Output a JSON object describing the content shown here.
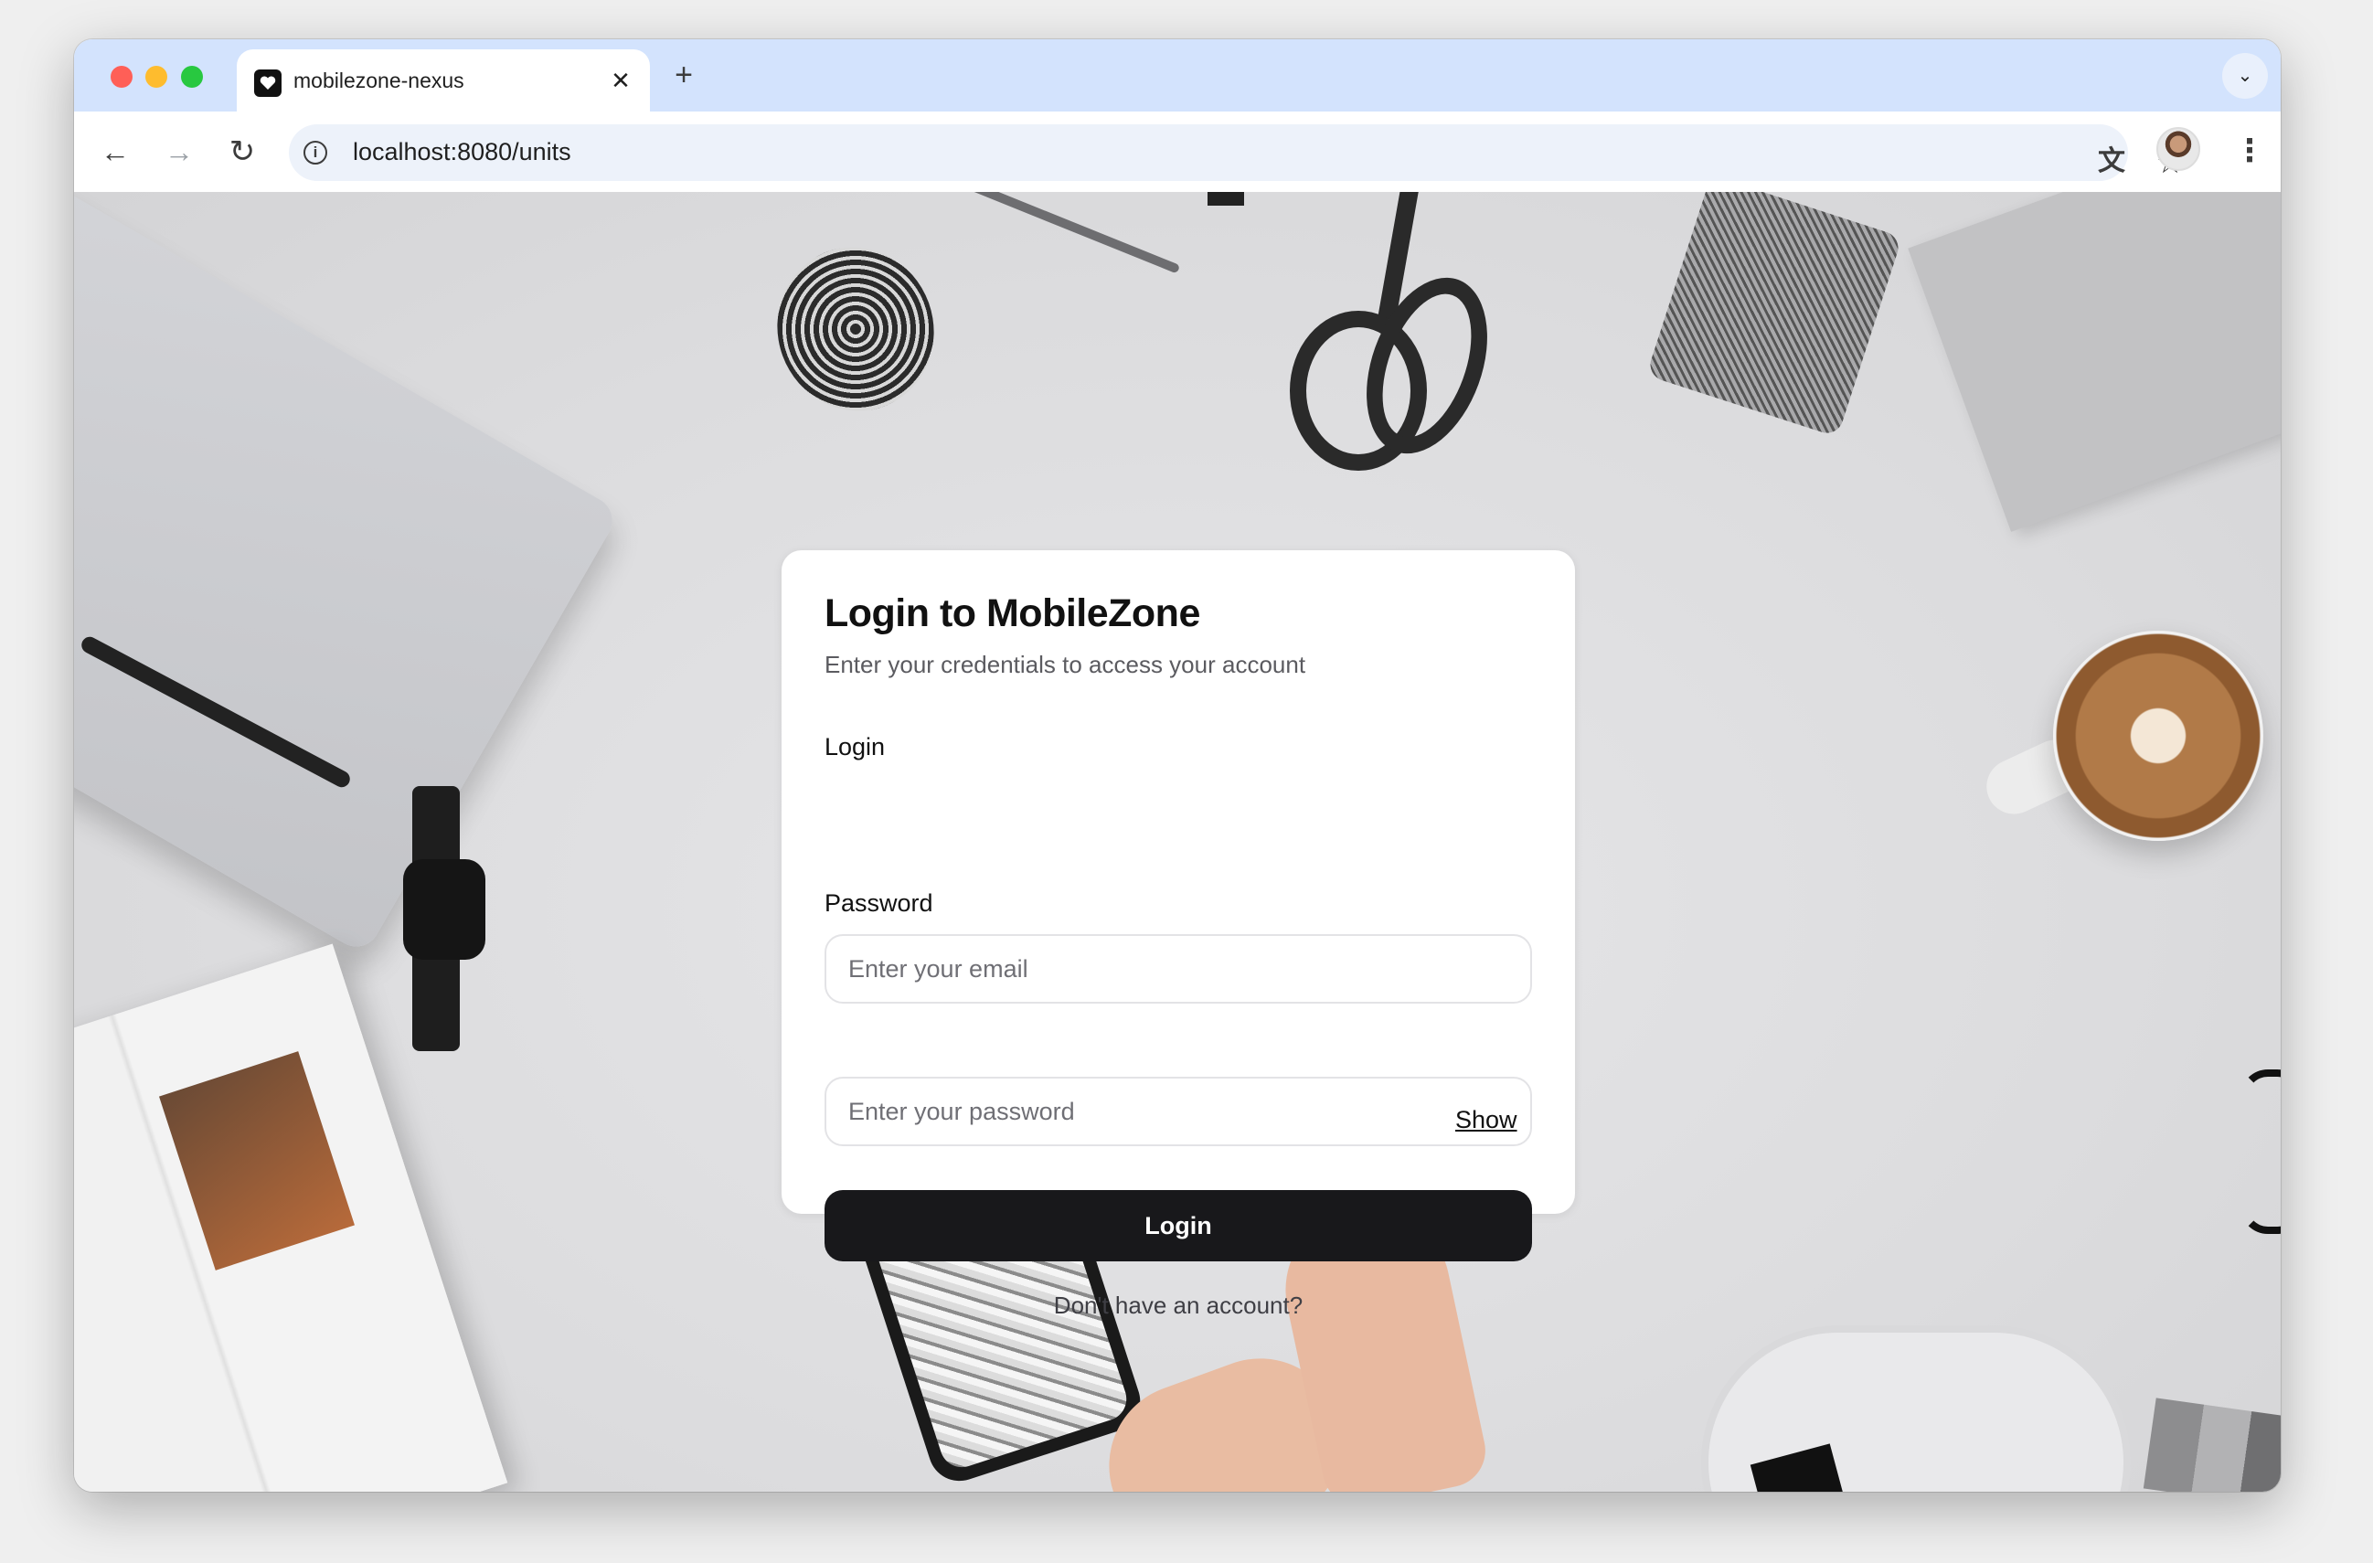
{
  "browser": {
    "tab": {
      "title": "mobilezone-nexus",
      "favicon": "heart-icon",
      "close": "✕"
    },
    "new_tab": "+",
    "tab_search": "⌄",
    "url": "localhost:8080/units",
    "traffic_colors": {
      "close": "#ff5f57",
      "minimize": "#febc2e",
      "zoom": "#28c840"
    },
    "icons": {
      "back": "←",
      "forward": "→",
      "reload": "↻",
      "info": "i",
      "translate": "文",
      "star": "☆",
      "menu": "⋮"
    }
  },
  "login_card": {
    "title": "Login to MobileZone",
    "subtitle": "Enter your credentials to access your account",
    "login_label": "Login",
    "email_placeholder": "Enter your email",
    "email_value": "",
    "password_label": "Password",
    "password_placeholder": "Enter your password",
    "password_value": "",
    "show_label": "Show",
    "submit_label": "Login",
    "signup_text": "Don't have an account?"
  },
  "colors": {
    "tabstrip": "#d3e3fd",
    "omnibox": "#edf2fa",
    "primary_button": "#18181b",
    "page_background": "#e3e3e5"
  }
}
